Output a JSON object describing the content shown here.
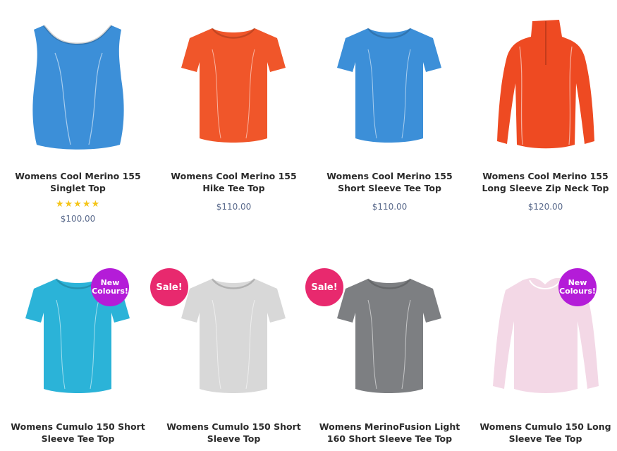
{
  "products": [
    {
      "line1": "Womens Cool Merino 155",
      "line2": "Singlet Top",
      "price": "$100.00",
      "rating": 5,
      "color": "#3c8fd8",
      "style": "singlet"
    },
    {
      "line1": "Womens Cool Merino 155",
      "line2": "Hike Tee Top",
      "price": "$110.00",
      "rating": 0,
      "color": "#f0562a",
      "style": "tee"
    },
    {
      "line1": "Womens Cool Merino 155",
      "line2": "Short Sleeve Tee Top",
      "price": "$110.00",
      "rating": 0,
      "color": "#3c8fd8",
      "style": "tee"
    },
    {
      "line1": "Womens Cool Merino 155",
      "line2": "Long Sleeve Zip Neck Top",
      "price": "$120.00",
      "rating": 0,
      "color": "#ee4a22",
      "style": "zip"
    },
    {
      "line1": "Womens Cumulo 150 Short",
      "line2": "Sleeve Tee Top",
      "price": "",
      "rating": 0,
      "color": "#2bb3d8",
      "style": "tee",
      "badge": "New\nColours!"
    },
    {
      "line1": "Womens Cumulo 150 Short",
      "line2": "Sleeve Top",
      "price": "",
      "rating": 0,
      "color": "#d8d8d8",
      "style": "tee",
      "badge": "Sale!"
    },
    {
      "line1": "Womens MerinoFusion Light",
      "line2": "160 Short Sleeve Tee Top",
      "price": "",
      "rating": 0,
      "color": "#7d7f82",
      "style": "tee",
      "badge": "Sale!"
    },
    {
      "line1": "Womens Cumulo 150 Long",
      "line2": "Sleeve Tee Top",
      "price": "",
      "rating": 0,
      "color": "#f3d8e6",
      "style": "long",
      "badge": "New\nColours!"
    }
  ],
  "colors": {
    "star": "#f5c518",
    "star_empty": "#e2e2e2",
    "new_badge": "#b41cd8",
    "sale_badge": "#e8296e"
  },
  "icons": {
    "star": "star-icon"
  }
}
